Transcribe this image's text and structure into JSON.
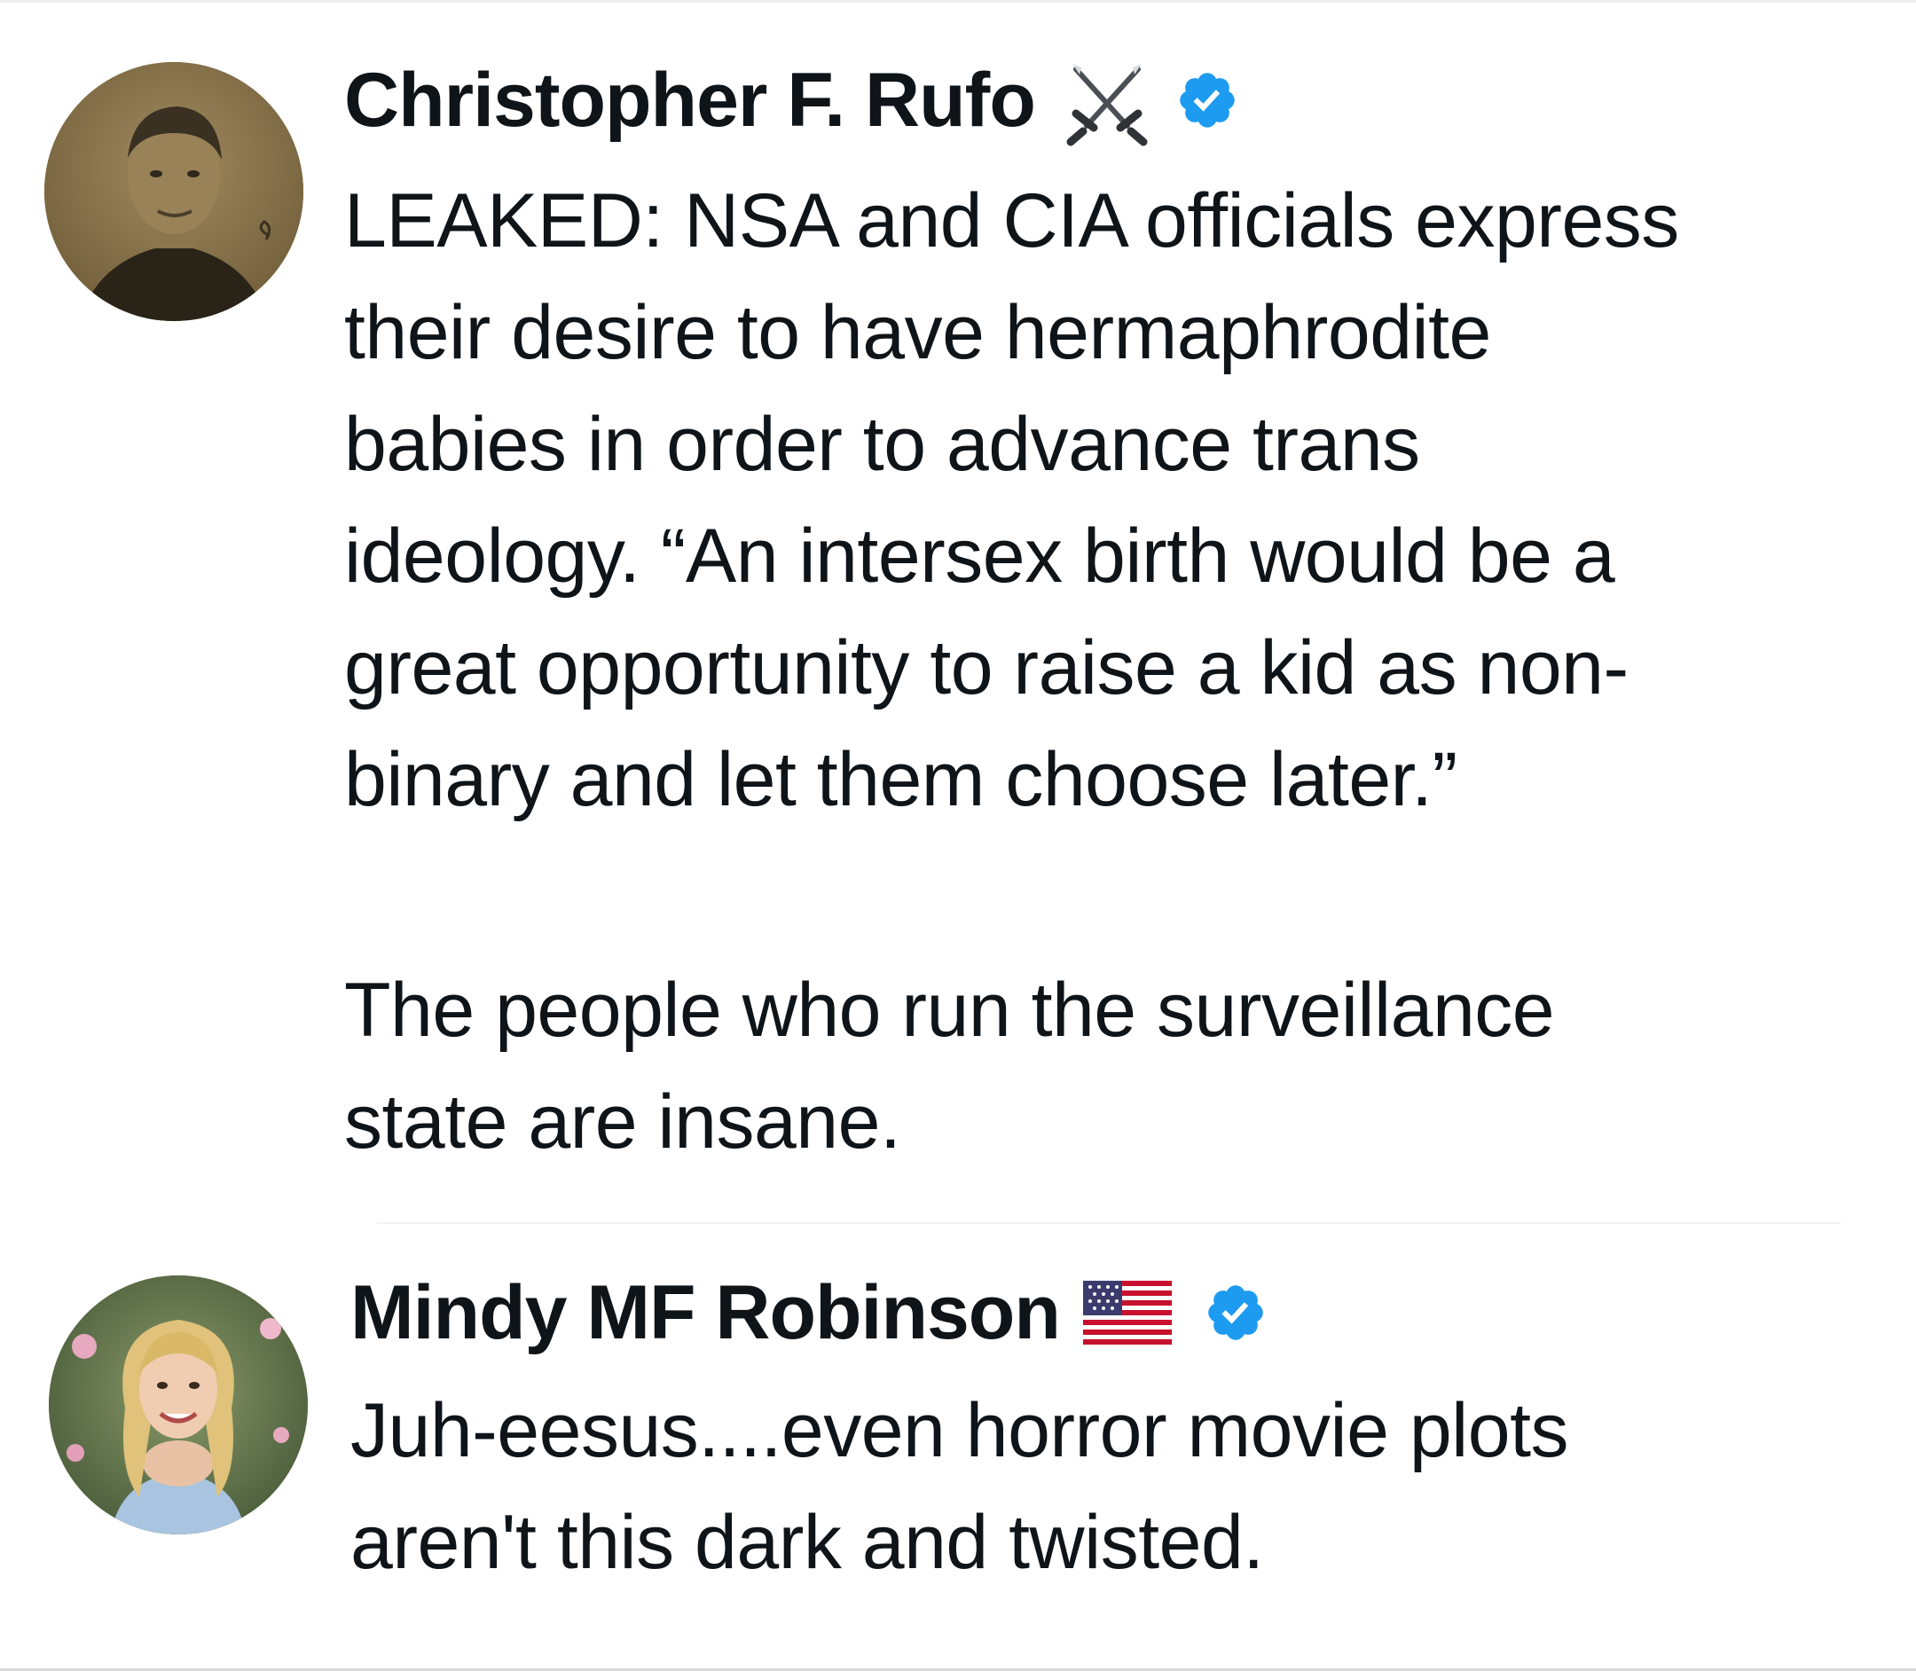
{
  "tweets": [
    {
      "author": {
        "name": "Christopher F. Rufo",
        "name_emoji": "crossed-swords-icon",
        "verified": true,
        "avatar": "avatar-photo"
      },
      "text_lines": [
        "LEAKED: NSA and CIA officials express",
        "their desire to have hermaphrodite",
        "babies in order to advance trans",
        "ideology. “An intersex birth would be a",
        "great opportunity to raise a kid as non-",
        "binary and let them choose later.”"
      ],
      "text_lines_2": [
        "The people who run the surveillance",
        "state are insane."
      ]
    },
    {
      "author": {
        "name": "Mindy MF Robinson",
        "name_emoji": "us-flag-icon",
        "verified": true,
        "avatar": "avatar-photo"
      },
      "text_lines": [
        "Juh-eesus....even horror movie plots",
        "aren't this dark and twisted."
      ]
    }
  ],
  "colors": {
    "text": "#0f1419",
    "verified_blue": "#1d9bf0",
    "divider": "#eff3f4"
  }
}
